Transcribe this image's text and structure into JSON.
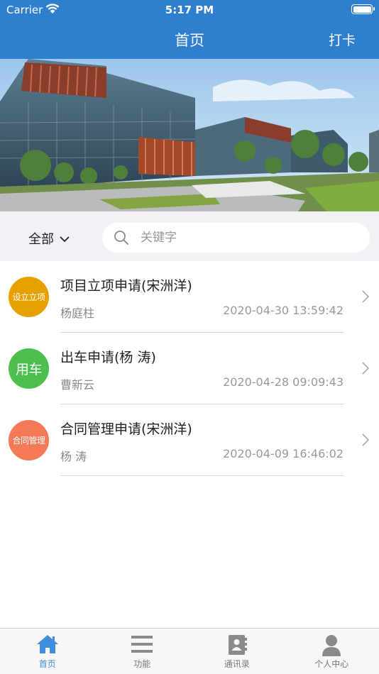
{
  "status_bar": {
    "carrier": "Carrier",
    "time": "5:17 PM"
  },
  "nav": {
    "title": "首页",
    "right_button": "打卡"
  },
  "filter": {
    "selected": "全部",
    "search_placeholder": "关键字"
  },
  "list": [
    {
      "badge": "设立立项",
      "badge_color": "#e6a100",
      "title": "项目立项申请(宋洲洋)",
      "user": "杨庭柱",
      "time": "2020-04-30 13:59:42"
    },
    {
      "badge": "用车",
      "badge_color": "#4cbf4e",
      "title": "出车申请(杨 涛)",
      "user": "曹新云",
      "time": "2020-04-28 09:09:43"
    },
    {
      "badge": "合同管理",
      "badge_color": "#f27a57",
      "title": "合同管理申请(宋洲洋)",
      "user": "杨 涛",
      "time": "2020-04-09 16:46:02"
    }
  ],
  "tabs": [
    {
      "label": "首页",
      "icon": "home-icon",
      "active": true
    },
    {
      "label": "功能",
      "icon": "menu-icon",
      "active": false
    },
    {
      "label": "通讯录",
      "icon": "contacts-icon",
      "active": false
    },
    {
      "label": "个人中心",
      "icon": "person-icon",
      "active": false
    }
  ],
  "colors": {
    "primary": "#2f7fcf",
    "tab_active": "#3d8fdc",
    "tab_inactive": "#777777"
  }
}
